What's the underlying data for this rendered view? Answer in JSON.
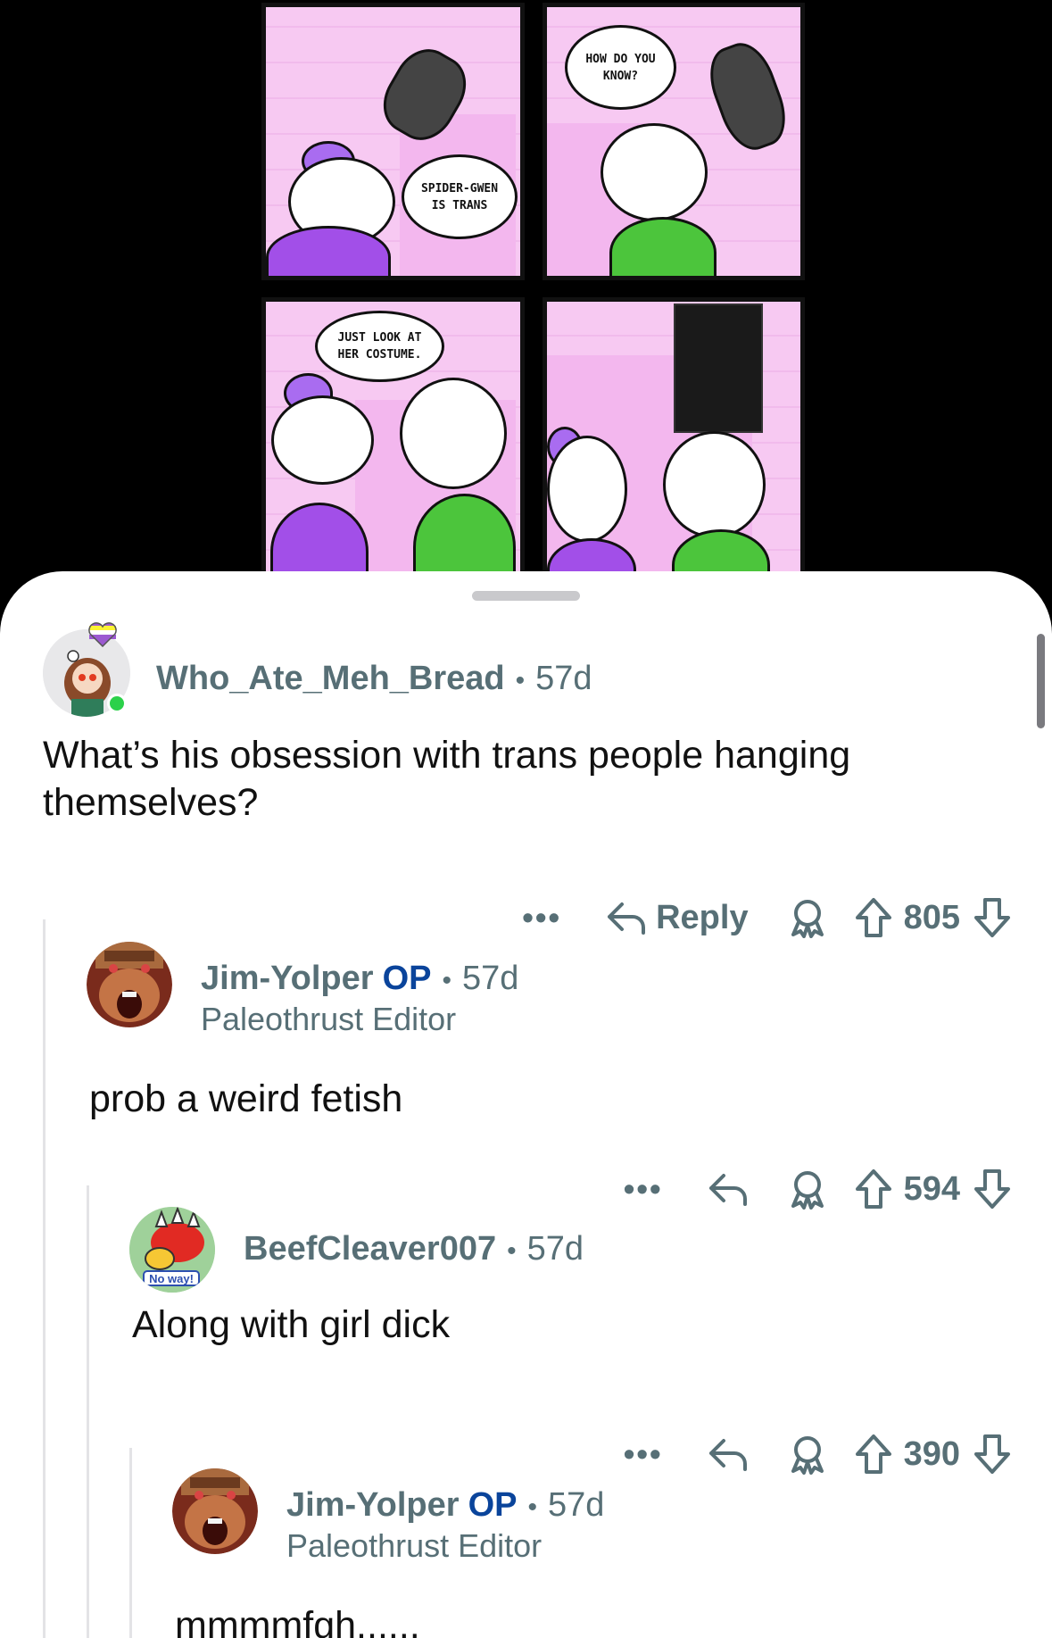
{
  "comic": {
    "panel1_text": "SPIDER-GWEN IS TRANS",
    "panel2_text": "HOW DO YOU KNOW?",
    "panel3_text": "JUST LOOK AT HER COSTUME."
  },
  "comments": [
    {
      "username": "Who_Ate_Meh_Bread",
      "age": "57d",
      "body": "What’s his obsession with trans people hanging themselves?",
      "reply_label": "Reply",
      "score": "805"
    },
    {
      "username": "Jim-Yolper",
      "op_badge": "OP",
      "age": "57d",
      "flair": "Paleothrust Editor",
      "body": "prob a weird fetish",
      "score": "594"
    },
    {
      "username": "BeefCleaver007",
      "age": "57d",
      "avatar_text": "No way!",
      "body": "Along with girl dick",
      "score": "390"
    },
    {
      "username": "Jim-Yolper",
      "op_badge": "OP",
      "age": "57d",
      "flair": "Paleothrust Editor",
      "body": "mmmmfgh.,...,"
    }
  ],
  "icons": {
    "more": "more-dots-icon",
    "reply": "reply-arrow-icon",
    "award": "award-icon",
    "upvote": "upvote-arrow-icon",
    "downvote": "downvote-arrow-icon"
  },
  "colors": {
    "accent_op": "#0a449b",
    "meta_gray": "#576f76",
    "online": "#2bd14a"
  }
}
